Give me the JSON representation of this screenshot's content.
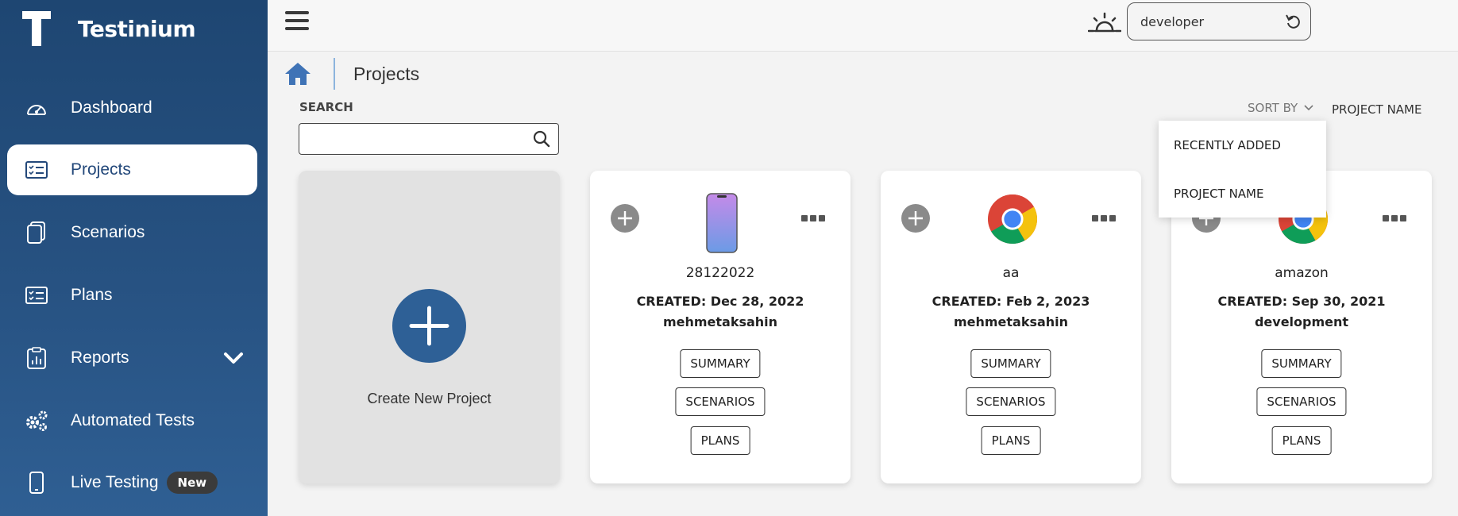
{
  "brand": {
    "name": "Testinium",
    "logo_letter": "T"
  },
  "sidebar": {
    "items": [
      {
        "label": "Dashboard",
        "icon": "gauge-icon"
      },
      {
        "label": "Projects",
        "icon": "list-card-icon",
        "active": true
      },
      {
        "label": "Scenarios",
        "icon": "copy-icon"
      },
      {
        "label": "Plans",
        "icon": "list-card-icon"
      },
      {
        "label": "Reports",
        "icon": "report-icon",
        "expandable": true
      },
      {
        "label": "Automated Tests",
        "icon": "gears-icon"
      },
      {
        "label": "Live Testing",
        "icon": "phone-icon",
        "badge": "New"
      }
    ]
  },
  "topbar": {
    "environment": "developer"
  },
  "breadcrumb": {
    "title": "Projects"
  },
  "search": {
    "label": "SEARCH",
    "placeholder": ""
  },
  "sort": {
    "label": "SORT BY",
    "value": "PROJECT NAME",
    "options": [
      "RECENTLY ADDED",
      "PROJECT NAME"
    ]
  },
  "create_card": {
    "label": "Create New Project"
  },
  "projects": [
    {
      "name": "28122022",
      "created": "CREATED: Dec 28, 2022",
      "owner": "mehmetaksahin",
      "platform": "mobile",
      "buttons": [
        "SUMMARY",
        "SCENARIOS",
        "PLANS"
      ]
    },
    {
      "name": "aa",
      "created": "CREATED: Feb 2, 2023",
      "owner": "mehmetaksahin",
      "platform": "chrome",
      "buttons": [
        "SUMMARY",
        "SCENARIOS",
        "PLANS"
      ]
    },
    {
      "name": "amazon",
      "created": "CREATED: Sep 30, 2021",
      "owner": "development",
      "platform": "chrome",
      "buttons": [
        "SUMMARY",
        "SCENARIOS",
        "PLANS"
      ]
    }
  ],
  "colors": {
    "sidebar": "#23487a",
    "accent": "#2e6096",
    "home_icon": "#3f73b6"
  }
}
